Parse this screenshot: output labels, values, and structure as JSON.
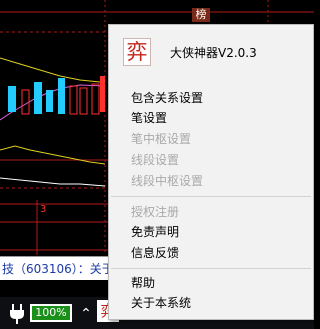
{
  "chart": {
    "tag": "榜",
    "tick_label": "3"
  },
  "ticker": {
    "text": "技（603106）：关于"
  },
  "taskbar": {
    "battery": "100%",
    "app_glyph": "弈",
    "icons": [
      "plug-icon",
      "battery-icon",
      "chevron-up-icon",
      "app-tray-icon",
      "tray-icon-2",
      "tray-icon-3",
      "tray-icon-4",
      "tray-icon-5",
      "tray-icon-6"
    ]
  },
  "menu": {
    "logo_glyph": "弈",
    "title": "大侠神器V2.0.3",
    "groups": [
      [
        {
          "label": "包含关系设置",
          "enabled": true
        },
        {
          "label": "笔设置",
          "enabled": true
        },
        {
          "label": "笔中枢设置",
          "enabled": false
        },
        {
          "label": "线段设置",
          "enabled": false
        },
        {
          "label": "线段中枢设置",
          "enabled": false
        }
      ],
      [
        {
          "label": "授权注册",
          "enabled": false
        },
        {
          "label": "免责声明",
          "enabled": true
        },
        {
          "label": "信息反馈",
          "enabled": true
        }
      ],
      [
        {
          "label": "帮助",
          "enabled": true
        },
        {
          "label": "关于本系统",
          "enabled": true
        }
      ]
    ]
  },
  "colors": {
    "accent_red": "#c0261c",
    "disabled": "#a9a9a9",
    "ticker_blue": "#1b3aa6"
  }
}
